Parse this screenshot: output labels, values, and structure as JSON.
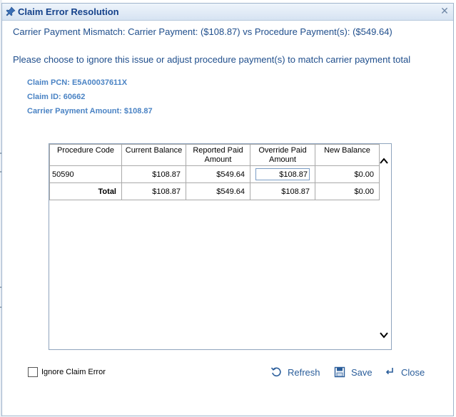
{
  "dialog": {
    "title": "Claim Error Resolution",
    "mismatch_message": "Carrier Payment Mismatch: Carrier Payment: ($108.87) vs Procedure Payment(s): ($549.64)",
    "instruction": "Please choose to ignore this issue or adjust procedure payment(s) to match carrier payment total"
  },
  "claim_info": {
    "pcn": "Claim PCN: E5A00037611X",
    "claim_id": "Claim ID: 60662",
    "carrier_payment_amount": "Carrier Payment Amount: $108.87"
  },
  "grid": {
    "columns": [
      "Procedure Code",
      "Current Balance",
      "Reported Paid Amount",
      "Override Paid Amount",
      "New Balance"
    ],
    "rows": [
      {
        "procedure_code": "50590",
        "current_balance": "$108.87",
        "reported_paid": "$549.64",
        "override_paid": "$108.87",
        "new_balance": "$0.00"
      }
    ],
    "total": {
      "label": "Total",
      "current_balance": "$108.87",
      "reported_paid": "$549.64",
      "override_paid": "$108.87",
      "new_balance": "$0.00"
    }
  },
  "footer": {
    "ignore_label": "Ignore Claim Error",
    "ignore_checked": false,
    "refresh_label": "Refresh",
    "save_label": "Save",
    "close_label": "Close"
  },
  "colors": {
    "title_text": "#15428b",
    "message_text": "#1f4e8c",
    "info_text": "#4a83c4",
    "button_text": "#2a5d9a"
  }
}
